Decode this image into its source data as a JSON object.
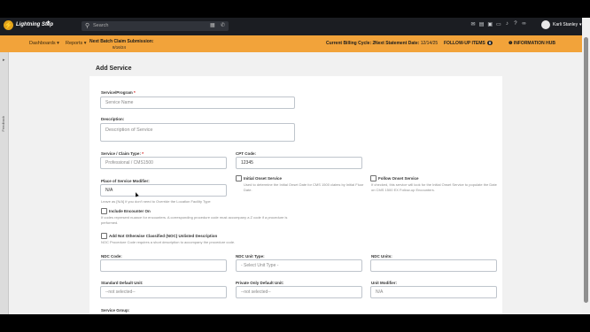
{
  "app": {
    "brand": "Lightning Step",
    "logo_letter": "⚡",
    "search_placeholder": "Search",
    "user_name": "Karli Stanley"
  },
  "nav": {
    "dashboards": "Dashboards ▾",
    "reports": "Reports ▾"
  },
  "banner": {
    "batch_label": "Next Batch Claim Submission:",
    "batch_value": "8/16/24",
    "billing_cycle": "Current Billing Cycle: 2",
    "statement_label": "Next Statement Date:",
    "statement_value": "12/14/25",
    "follow_up": "FOLLOW-UP ITEMS",
    "follow_up_count": "0",
    "info_hub": "INFORMATION HUB"
  },
  "rail": {
    "label": "Feedback"
  },
  "page": {
    "title": "Add Service"
  },
  "form": {
    "service_program": {
      "label": "Service/Program",
      "required": "*",
      "placeholder": "Service Name"
    },
    "description": {
      "label": "Description:",
      "placeholder": "Description of Service"
    },
    "service_claim_type": {
      "label": "Service / Claim Type:",
      "required": "*",
      "value": "Professional / CMS1500"
    },
    "cpt_code": {
      "label": "CPT Code:",
      "value": "12345"
    },
    "place_of_service": {
      "label": "Place of Service Modifier:",
      "value": "N/A",
      "help": "Leave as [N/A] if you don't need to Override the Location Facility Type"
    },
    "initial_onset": {
      "label": "Initial Onset Service",
      "help": "Used to determine the Initial Onset Date for CMS 1500 claims by Initial Fluor Date."
    },
    "follow_onset": {
      "label": "Follow Onset Service",
      "help": "If checked, this service will look for the Initial Onset Service to populate the Date on CMS 1500 EX Follow-up Encounters."
    },
    "include_encounter": {
      "label": "Include Encounter On",
      "help": "If codes represent nuance for encounters. A corresponding procedure code must accompany a Z code if a procedure is performed."
    },
    "noc": {
      "label": "Add Not Otherwise Classified (NOC) Unlisted Description",
      "help": "NOC Procedure Code requires a short description to accompany the procedure code."
    },
    "ndc_code": {
      "label": "NDC Code:"
    },
    "ndc_unit_type": {
      "label": "NDC Unit Type:",
      "value": "- Select Unit Type -"
    },
    "ndc_units": {
      "label": "NDC Units:"
    },
    "standard_default_unit": {
      "label": "Standard Default Unit:",
      "value": "--not selected--"
    },
    "private_default_unit": {
      "label": "Private Only Default Unit:",
      "value": "--not selected--"
    },
    "unit_modifier": {
      "label": "Unit Modifier:",
      "value": "N/A"
    },
    "service_group": {
      "label": "Service Group:"
    }
  }
}
